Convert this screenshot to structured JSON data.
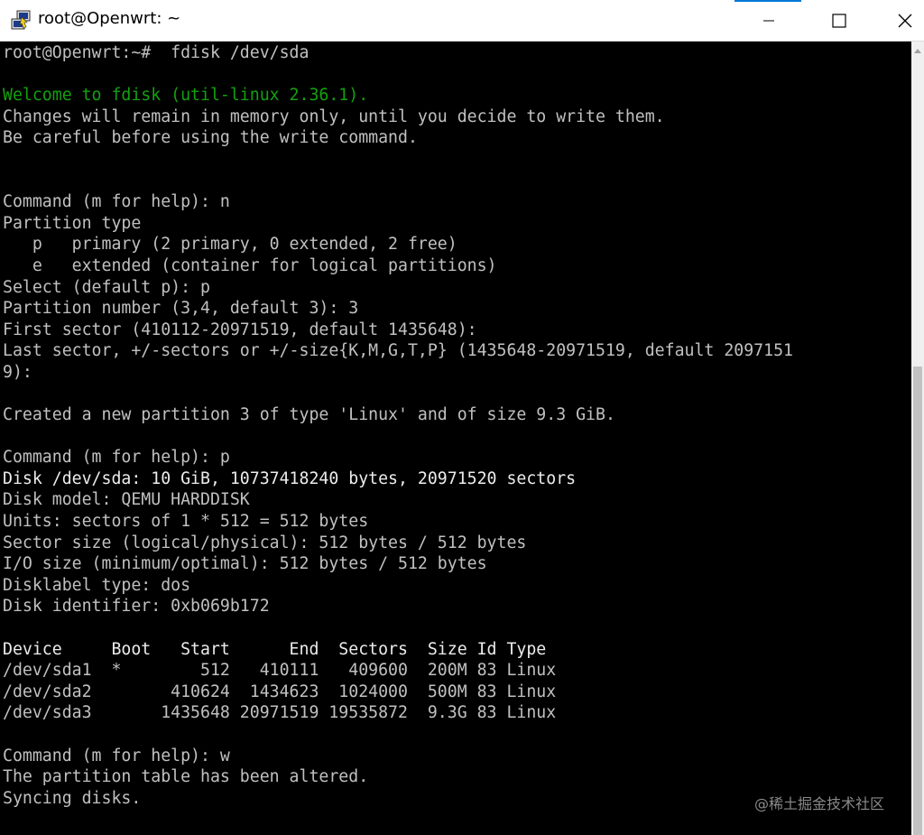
{
  "window": {
    "title": "root@Openwrt: ~",
    "icon": "putty-icon",
    "controls": [
      "minimize-icon",
      "maximize-icon",
      "close-icon"
    ]
  },
  "colors": {
    "terminal_bg": "#000000",
    "terminal_fg": "#c0c0c0",
    "welcome_green": "#13a10e",
    "accent": "#0078d7"
  },
  "terminal": {
    "lines": [
      {
        "text": "root@Openwrt:~#  fdisk /dev/sda",
        "style": "normal"
      },
      {
        "text": "",
        "style": "normal"
      },
      {
        "text": "Welcome to fdisk (util-linux 2.36.1).",
        "style": "green"
      },
      {
        "text": "Changes will remain in memory only, until you decide to write them.",
        "style": "normal"
      },
      {
        "text": "Be careful before using the write command.",
        "style": "normal"
      },
      {
        "text": "",
        "style": "normal"
      },
      {
        "text": "",
        "style": "normal"
      },
      {
        "text": "Command (m for help): n",
        "style": "normal"
      },
      {
        "text": "Partition type",
        "style": "normal"
      },
      {
        "text": "   p   primary (2 primary, 0 extended, 2 free)",
        "style": "normal"
      },
      {
        "text": "   e   extended (container for logical partitions)",
        "style": "normal"
      },
      {
        "text": "Select (default p): p",
        "style": "normal"
      },
      {
        "text": "Partition number (3,4, default 3): 3",
        "style": "normal"
      },
      {
        "text": "First sector (410112-20971519, default 1435648):",
        "style": "normal"
      },
      {
        "text": "Last sector, +/-sectors or +/-size{K,M,G,T,P} (1435648-20971519, default 2097151",
        "style": "normal"
      },
      {
        "text": "9):",
        "style": "normal"
      },
      {
        "text": "",
        "style": "normal"
      },
      {
        "text": "Created a new partition 3 of type 'Linux' and of size 9.3 GiB.",
        "style": "normal"
      },
      {
        "text": "",
        "style": "normal"
      },
      {
        "text": "Command (m for help): p",
        "style": "normal"
      },
      {
        "text": "Disk /dev/sda: 10 GiB, 10737418240 bytes, 20971520 sectors",
        "style": "bright"
      },
      {
        "text": "Disk model: QEMU HARDDISK",
        "style": "normal"
      },
      {
        "text": "Units: sectors of 1 * 512 = 512 bytes",
        "style": "normal"
      },
      {
        "text": "Sector size (logical/physical): 512 bytes / 512 bytes",
        "style": "normal"
      },
      {
        "text": "I/O size (minimum/optimal): 512 bytes / 512 bytes",
        "style": "normal"
      },
      {
        "text": "Disklabel type: dos",
        "style": "normal"
      },
      {
        "text": "Disk identifier: 0xb069b172",
        "style": "normal"
      },
      {
        "text": "",
        "style": "normal"
      },
      {
        "text": "Device     Boot   Start      End  Sectors  Size Id Type",
        "style": "bright"
      },
      {
        "text": "/dev/sda1  *        512   410111   409600  200M 83 Linux",
        "style": "normal"
      },
      {
        "text": "/dev/sda2        410624  1434623  1024000  500M 83 Linux",
        "style": "normal"
      },
      {
        "text": "/dev/sda3       1435648 20971519 19535872  9.3G 83 Linux",
        "style": "normal"
      },
      {
        "text": "",
        "style": "normal"
      },
      {
        "text": "Command (m for help): w",
        "style": "normal"
      },
      {
        "text": "The partition table has been altered.",
        "style": "normal"
      },
      {
        "text": "Syncing disks.",
        "style": "normal"
      }
    ]
  },
  "watermark": "@稀土掘金技术社区"
}
